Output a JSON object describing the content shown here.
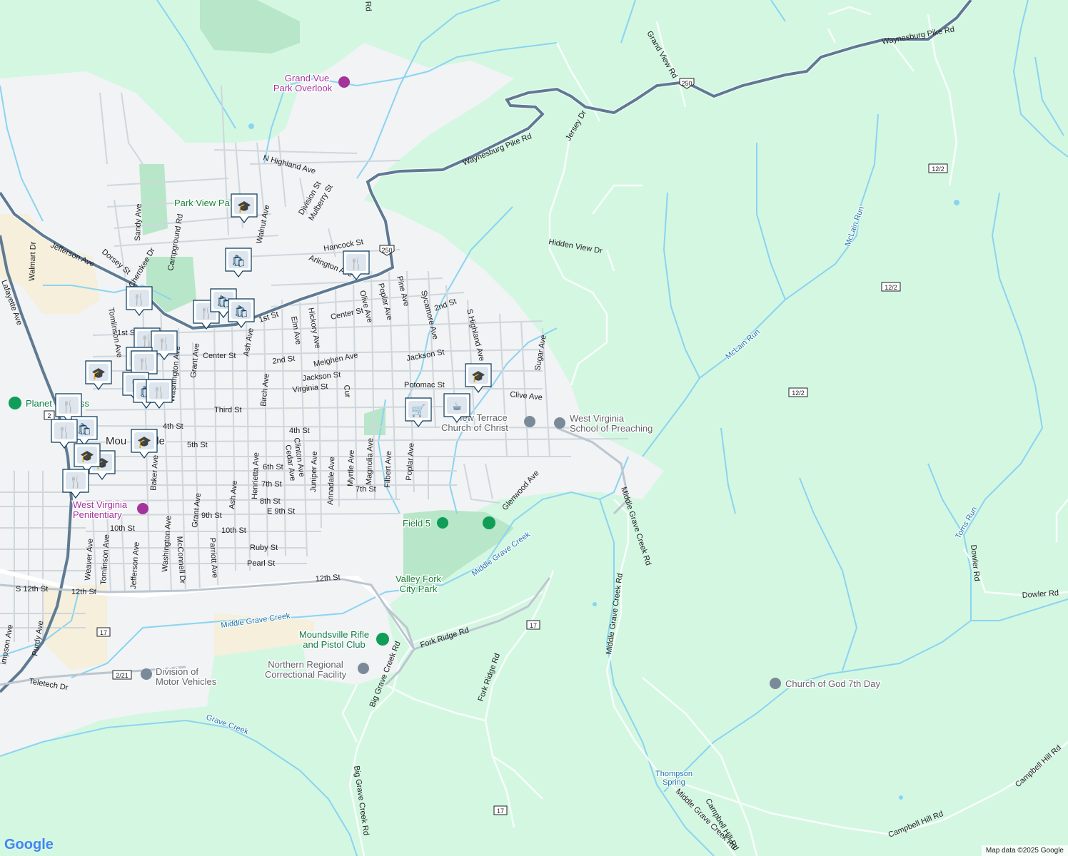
{
  "colors": {
    "green": "#d4f7e2",
    "urban": "#f1f3f4",
    "water": "#8ad4f1",
    "park": "#b8e6c8",
    "road_main": "#5f7a93",
    "road_minor": "#cfd6dd",
    "marker": "#0b3a5c",
    "industrial": "#f5efdc"
  },
  "attribution": "Map data ©2025 Google",
  "logo": "Google",
  "places": {
    "grand_vue": "Grand Vue Park Overlook",
    "grand_vue_l1": "Grand Vue",
    "grand_vue_l2": "Park Overlook",
    "park_view": "Park View Pa",
    "planet": "Planet Fitness",
    "planet_short": "Planet",
    "planet_tail": "ss",
    "moundsville": "Mou",
    "moundsville_tail": "lle",
    "wv_pen_l1": "West Virginia",
    "wv_pen_l2": "Penitentiary",
    "field5": "Field 5",
    "valley_fork_l1": "Valley Fork",
    "valley_fork_l2": "City Park",
    "rifle_l1": "Moundsville Rifle",
    "rifle_l2": "and Pistol Club",
    "nrcf_l1": "Northern Regional",
    "nrcf_l2": "Correctional Facility",
    "dmv_l1": "Division of",
    "dmv_l2": "Motor Vehicles",
    "terrace_l1": "View Terrace",
    "terrace_l2": "Church of Christ",
    "wvsp_l1": "West Virginia",
    "wvsp_l2": "School of Preaching",
    "cog": "Church of God 7th Day",
    "thompson_l1": "Thompson",
    "thompson_l2": "Spring"
  },
  "streams": {
    "mclain1": "McLain Run",
    "mclain2": "McLain Run",
    "toms": "Toms Run",
    "middle1": "Middle Grave Creek",
    "middle2": "Middle Grave Creek",
    "grave": "Grave Creek"
  },
  "roads": {
    "waynesburg1": "Waynesburg Pike Rd",
    "waynesburg2": "Waynesburg Pike Rd",
    "grand_view": "Grand View Rd",
    "jersey": "Jersey Dr",
    "hidden_view": "Hidden View Dr",
    "n_highland": "N Highland Ave",
    "division": "Division St",
    "mulberry": "Mulberry St",
    "hancock": "Hancock St",
    "arlington": "Arlington Ave",
    "jefferson": "Jefferson Ave",
    "walnut": "Walnut Ave",
    "sandy": "Sandy Ave",
    "dorsey": "Dorsey St",
    "cherokee": "Cherokee Dr",
    "campground": "Campground Rd",
    "walmart": "Walmart Dr",
    "lafayette": "Lafayette Ave",
    "tomlinson": "Tomlinson Ave",
    "first": "1st St",
    "first2": "1st St",
    "center": "Center St",
    "center2": "Center St",
    "second": "2nd St",
    "second2": "2nd St",
    "meighen": "Meighen Ave",
    "jackson": "Jackson St",
    "jackson2": "Jackson St",
    "virginia": "Virginia St",
    "third": "Third St",
    "fourth": "4th St",
    "fourth2": "4th St",
    "fifth": "5th St",
    "sixth": "6th St",
    "seventh": "7th St",
    "seventh2": "7th St",
    "eighth": "8th St",
    "e9th": "E 9th St",
    "ninth": "9th St",
    "tenth": "10th St",
    "tenth2": "10th St",
    "ruby": "Ruby St",
    "pearl": "Pearl St",
    "twelfth": "12th St",
    "twelfth2": "12th St",
    "s12th": "S 12th St",
    "potomac": "Potomac St",
    "clive": "Clive Ave",
    "sugar": "Sugar Ave",
    "s_highland": "S Highland Ave",
    "sycamore": "Sycamore Ave",
    "pine": "Pine Ave",
    "poplar": "Poplar Ave",
    "poplar2": "Poplar Ave",
    "olive": "Olive Ave",
    "hickory": "Hickory Ave",
    "elm": "Elm Ave",
    "ash": "Ash Ave",
    "ash2": "Ash Ave",
    "birch": "Birch Ave",
    "grant": "Grant Ave",
    "grant2": "Grant Ave",
    "washington": "Washington Ave",
    "washington2": "Washington Ave",
    "cedar": "Cedar Ave",
    "clinton": "Clinton Ave",
    "juniper": "Juniper Ave",
    "annadale": "Annadale Ave",
    "myrtle": "Myrtle Ave",
    "magnolia": "Magnolia Ave",
    "filbert": "Filbert Ave",
    "henrietta": "Henrietta Ave",
    "baker": "Baker Ave",
    "mcconnell": "McConnell Dr",
    "parriott": "Parriott Ave",
    "weaver": "Weaver Ave",
    "tomlinson2": "Tomlinson Ave",
    "jefferson2": "Jefferson Ave",
    "purdy": "Purdy Ave",
    "simpson": "impson Ave",
    "teletech": "Teletech Dr",
    "glenwood": "Glenwood Ave",
    "middle_grave_rd1": "Middle Grave Creek Rd",
    "middle_grave_rd2": "Middle Grave Creek Rd",
    "middle_grave_rd3": "Middle Grave Creek Rd",
    "fork_ridge1": "Fork Ridge Rd",
    "fork_ridge2": "Fork Ridge Rd",
    "big_grave1": "Big Grave Creek Rd",
    "big_grave2": "Big Grave Creek Rd",
    "campbell1": "Campbell Hill Rd",
    "campbell2": "Campbell Hill Rd",
    "campbell3": "Campbell Hill Rd",
    "dowler1": "Dowler Rd",
    "dowler2": "Dowler Rd",
    "top_rd": "Rd",
    "cut_ave": "Cur",
    "st_frag": "St",
    "ave_frag": "Ave",
    "jeff_frag": "Jeff",
    "ct_frag": "C",
    "b_frag": "b",
    "st_frag2": "St",
    "st_frag3": "St"
  },
  "shields": {
    "us250a": "250",
    "us250b": "250",
    "r17a": "17",
    "r17b": "17",
    "r17c": "17",
    "r122a": "12/2",
    "r122b": "12/2",
    "r122c": "12/2",
    "r221": "2/21",
    "r2": "2"
  },
  "markers": [
    {
      "icon": "school-icon"
    },
    {
      "icon": "shopping-bag-icon"
    },
    {
      "icon": "restaurant-icon"
    },
    {
      "icon": "restaurant-icon"
    },
    {
      "icon": "restaurant-icon"
    },
    {
      "icon": "shopping-bag-icon"
    },
    {
      "icon": "shopping-bag-icon"
    },
    {
      "icon": "restaurant-icon"
    },
    {
      "icon": "restaurant-icon"
    },
    {
      "icon": "restaurant-icon"
    },
    {
      "icon": "school-icon"
    },
    {
      "icon": "restaurant-icon"
    },
    {
      "icon": "restaurant-icon"
    },
    {
      "icon": "shopping-bag-icon"
    },
    {
      "icon": "restaurant-icon"
    },
    {
      "icon": "restaurant-icon"
    },
    {
      "icon": "shopping-bag-icon"
    },
    {
      "icon": "school-icon"
    },
    {
      "icon": "school-icon"
    },
    {
      "icon": "restaurant-icon"
    },
    {
      "icon": "school-icon"
    },
    {
      "icon": "restaurant-icon"
    },
    {
      "icon": "shopping-cart-icon"
    },
    {
      "icon": "coffee-icon"
    },
    {
      "icon": "school-icon"
    }
  ]
}
